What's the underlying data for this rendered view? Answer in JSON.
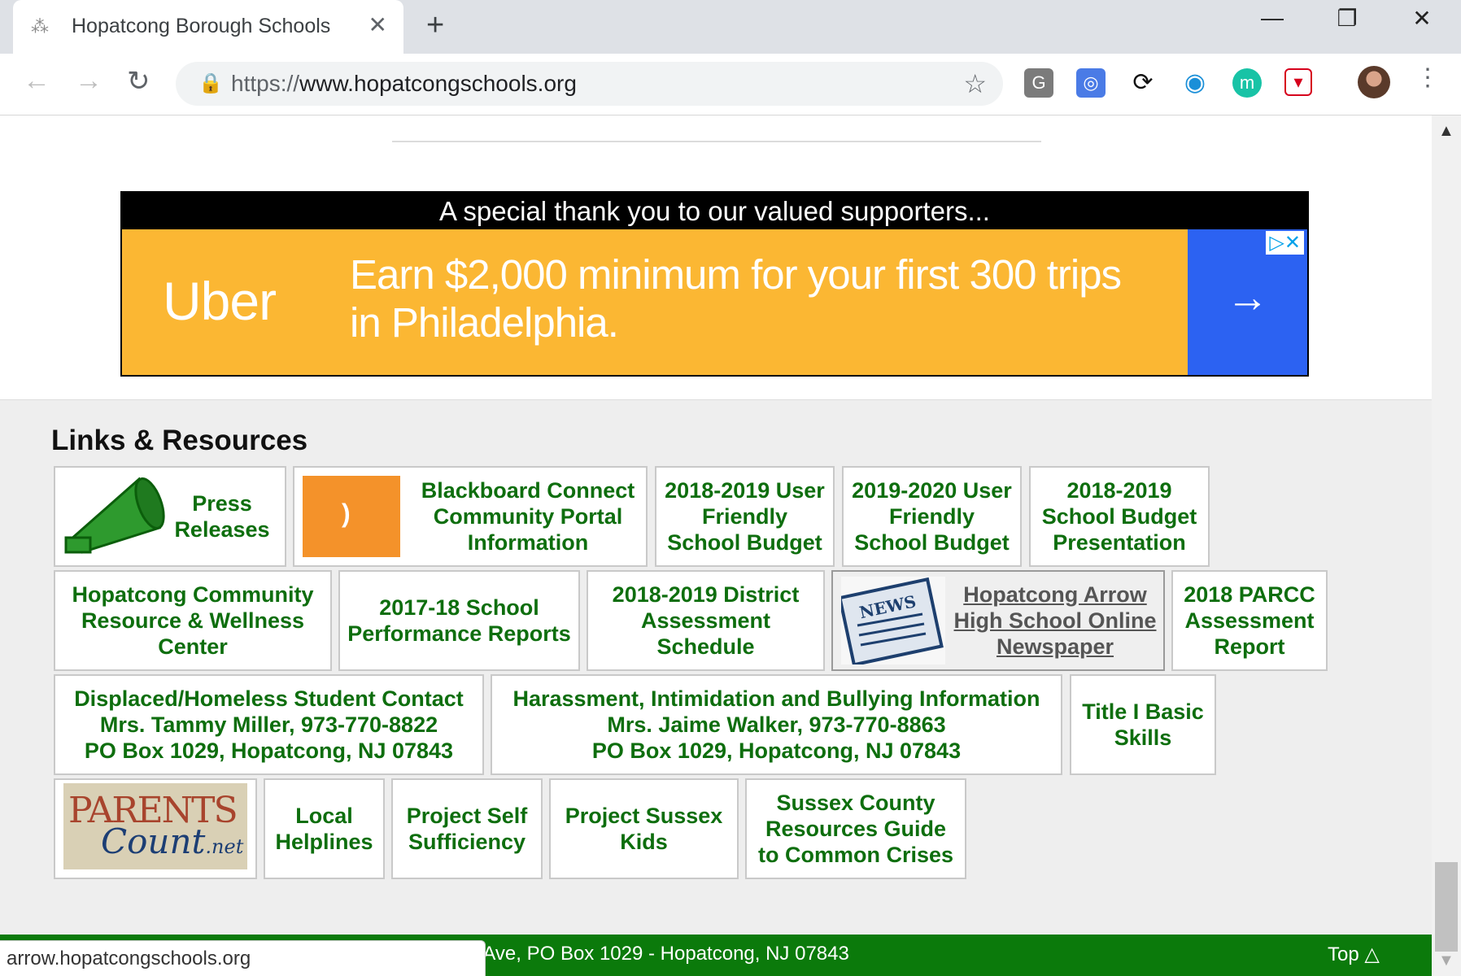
{
  "browser": {
    "tab_title": "Hopatcong Borough Schools",
    "tab_close": "✕",
    "new_tab": "+",
    "url_scheme": "https://",
    "url_host": "www.hopatcongschools.org",
    "window_minimize": "—",
    "window_restore": "❐",
    "window_close": "✕",
    "back": "←",
    "forward": "→",
    "reload": "↻",
    "lock": "🔒",
    "bookmark_star": "☆",
    "menu": "⋮",
    "extensions": [
      {
        "name": "G",
        "color": "#5f6368"
      },
      {
        "name": "camera",
        "color": "#4a7be6"
      },
      {
        "name": "sync",
        "color": "#111111"
      },
      {
        "name": "globe",
        "color": "#1a8fd8"
      },
      {
        "name": "m",
        "color": "#18c3a6"
      },
      {
        "name": "shield",
        "color": "#d6001c"
      }
    ]
  },
  "page": {
    "ad": {
      "heading": "A special thank you to our valued supporters...",
      "brand": "Uber",
      "message": "Earn $2,000 minimum for your first 300 trips in Philadelphia.",
      "cta_arrow": "→",
      "ad_choices": "▷✕"
    },
    "links": {
      "title": "Links & Resources",
      "row1": {
        "press": "Press Releases",
        "blackboard": "Blackboard Connect Community Portal Information",
        "budget_1819": "2018-2019 User Friendly School Budget",
        "budget_1920": "2019-2020 User Friendly School Budget",
        "budget_presentation": "2018-2019 School Budget Presentation"
      },
      "row2": {
        "community_center": "Hopatcong Community Resource & Wellness Center",
        "performance_reports": "2017-18 School Performance Reports",
        "assessment_schedule": "2018-2019 District Assessment Schedule",
        "newspaper": "Hopatcong Arrow High School Online Newspaper",
        "parcc": "2018 PARCC Assessment Report"
      },
      "row3": {
        "displaced_l1": "Displaced/Homeless Student Contact",
        "displaced_l2": "Mrs. Tammy Miller, 973-770-8822",
        "displaced_l3": "PO Box 1029, Hopatcong, NJ 07843",
        "harassment_l1": "Harassment, Intimidation and Bullying Information",
        "harassment_l2": "Mrs. Jaime Walker, 973-770-8863",
        "harassment_l3": "PO Box 1029, Hopatcong, NJ 07843",
        "title1": "Title I Basic Skills"
      },
      "row4": {
        "parents_count_logo": "PARENTS Count.net",
        "local_helplines": "Local Helplines",
        "project_self": "Project Self Sufficiency",
        "project_sussex": "Project Sussex Kids",
        "sussex_guide": "Sussex County Resources Guide to Common Crises"
      }
    },
    "footer": {
      "address": "r Ave, PO Box 1029 - Hopatcong, NJ 07843",
      "top_link": "Top △"
    },
    "status_url": "arrow.hopatcongschools.org"
  }
}
